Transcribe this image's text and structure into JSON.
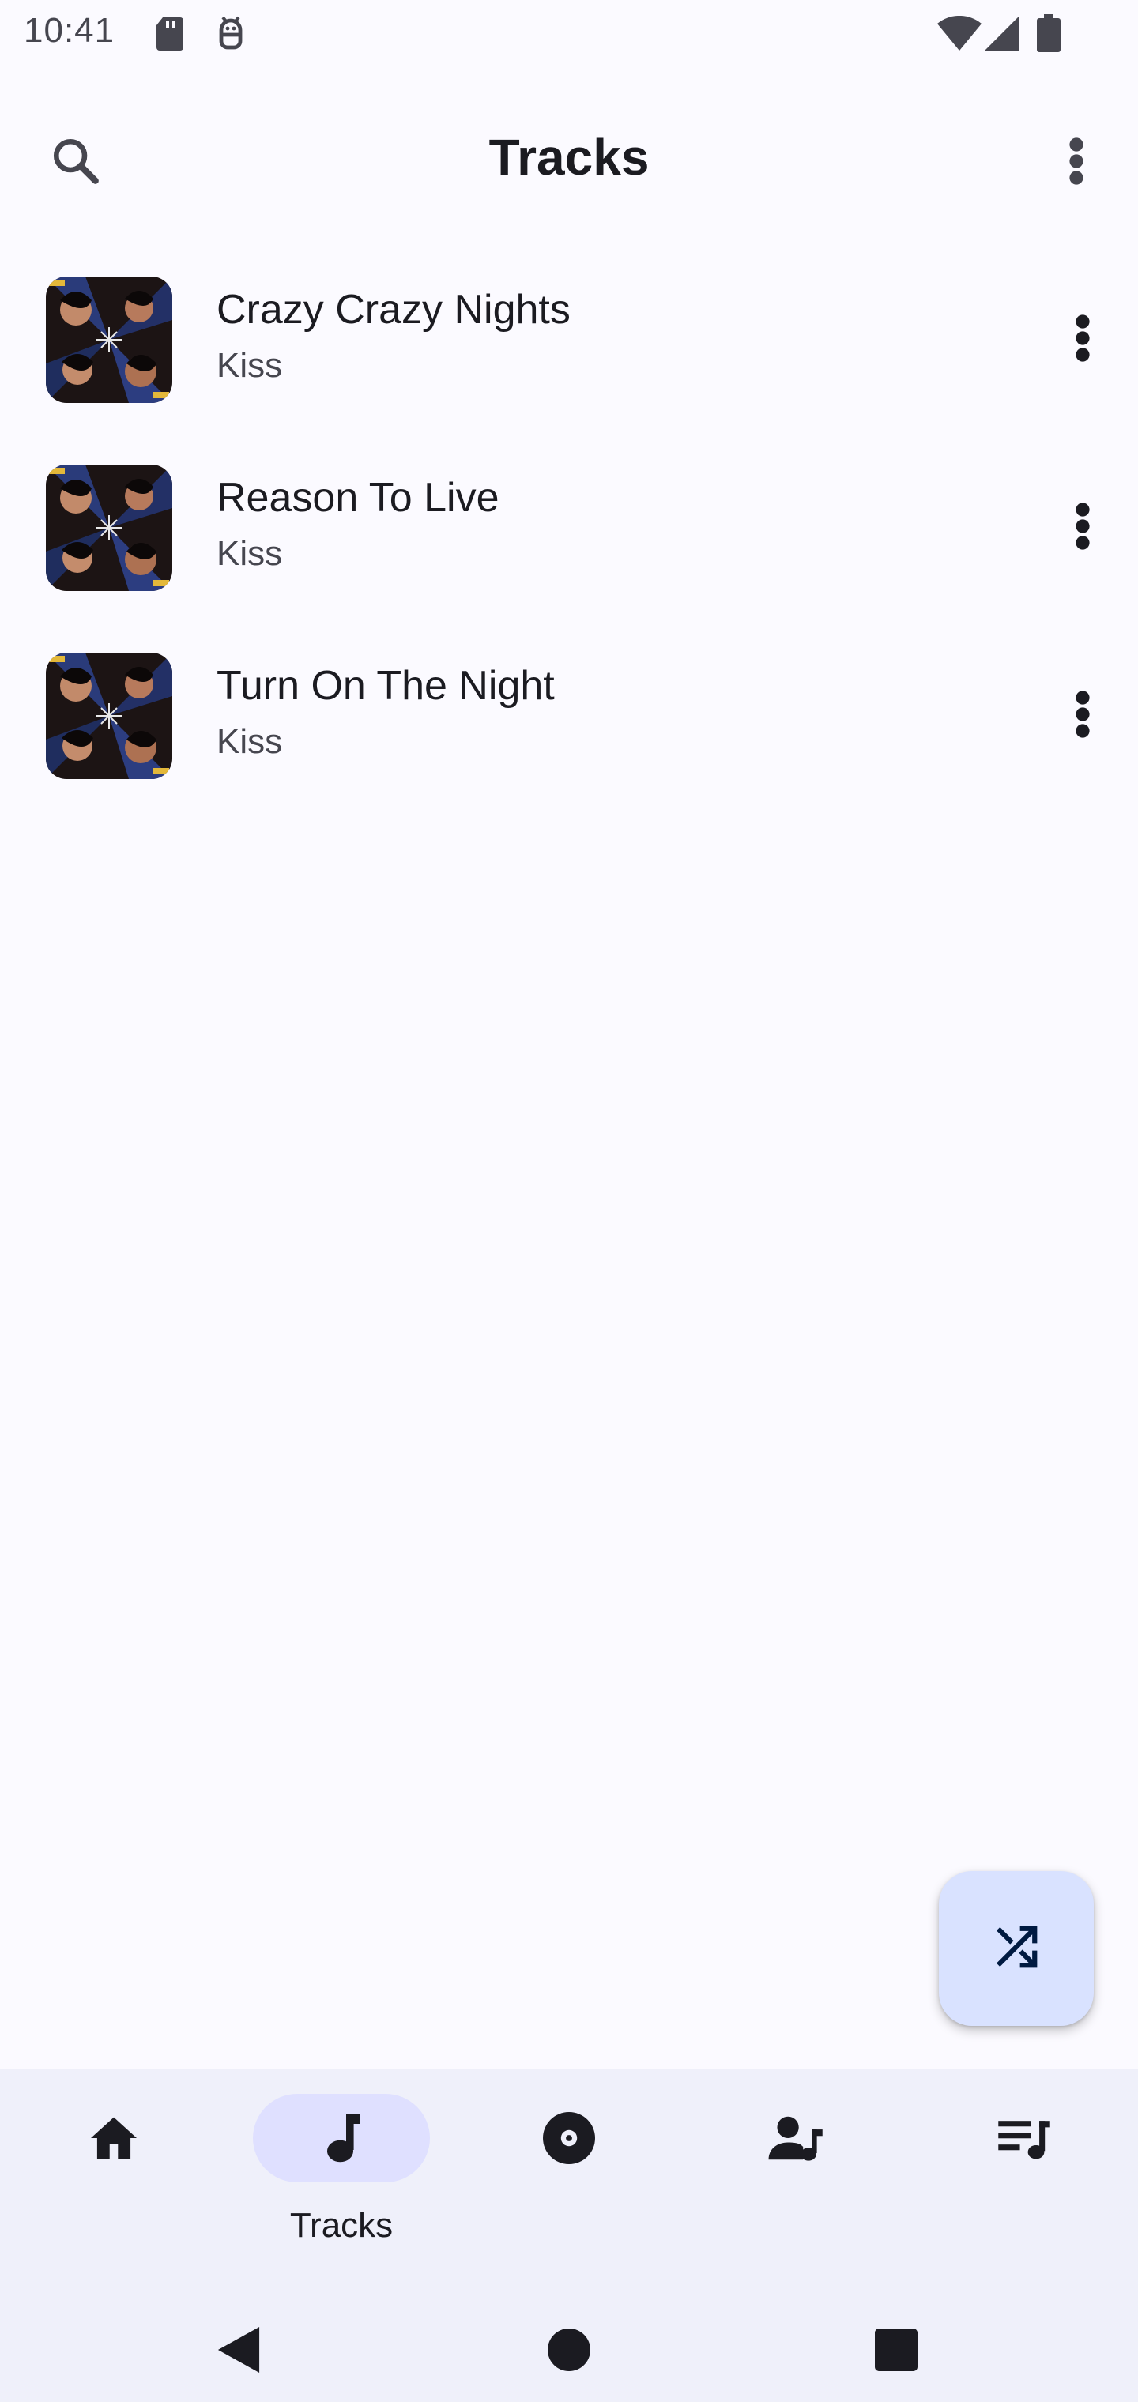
{
  "status_bar": {
    "time": "10:41",
    "left_icons": [
      "sd-card-icon",
      "android-debug-icon"
    ],
    "right_icons": [
      "wifi-icon",
      "cell-signal-icon",
      "battery-icon"
    ]
  },
  "app_bar": {
    "title": "Tracks",
    "left_icon": "search-icon",
    "right_icon": "more-vert-icon"
  },
  "tracks": [
    {
      "title": "Crazy Crazy Nights",
      "artist": "Kiss",
      "menu_icon": "more-vert-icon"
    },
    {
      "title": "Reason To Live",
      "artist": "Kiss",
      "menu_icon": "more-vert-icon"
    },
    {
      "title": "Turn On The Night",
      "artist": "Kiss",
      "menu_icon": "more-vert-icon"
    }
  ],
  "fab": {
    "icon": "shuffle-icon"
  },
  "bottom_nav": {
    "items": [
      {
        "icon": "home-icon",
        "label": "",
        "selected": false
      },
      {
        "icon": "music-note-icon",
        "label": "Tracks",
        "selected": true
      },
      {
        "icon": "album-icon",
        "label": "",
        "selected": false
      },
      {
        "icon": "artist-icon",
        "label": "",
        "selected": false
      },
      {
        "icon": "playlist-icon",
        "label": "",
        "selected": false
      }
    ]
  },
  "system_nav": {
    "icons": [
      "back-icon",
      "home-circle-icon",
      "recents-icon"
    ]
  },
  "colors": {
    "background": "#fbfaff",
    "nav_background": "#eff0fa",
    "nav_selected_pill": "#dfe0ff",
    "fab_background": "#d9e2ff",
    "primary_text": "#1b1b21",
    "secondary_text": "#46464f"
  }
}
